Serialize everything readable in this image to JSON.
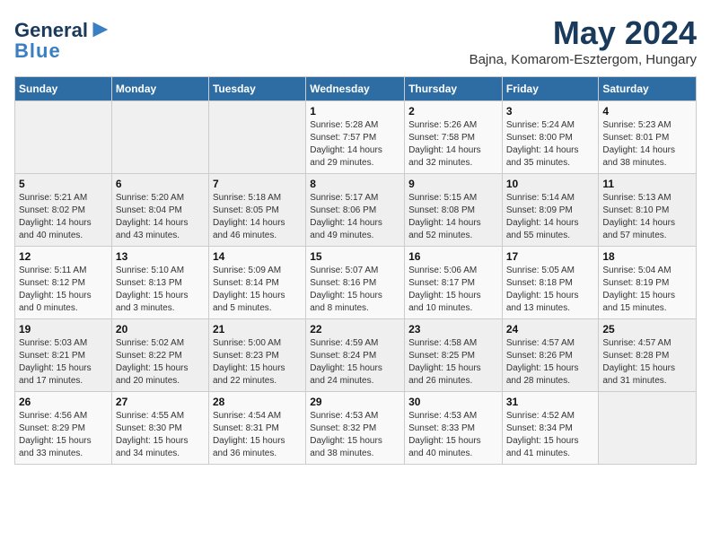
{
  "logo": {
    "line1": "General",
    "line2": "Blue"
  },
  "title": "May 2024",
  "subtitle": "Bajna, Komarom-Esztergom, Hungary",
  "days_header": [
    "Sunday",
    "Monday",
    "Tuesday",
    "Wednesday",
    "Thursday",
    "Friday",
    "Saturday"
  ],
  "weeks": [
    [
      {
        "num": "",
        "info": ""
      },
      {
        "num": "",
        "info": ""
      },
      {
        "num": "",
        "info": ""
      },
      {
        "num": "1",
        "info": "Sunrise: 5:28 AM\nSunset: 7:57 PM\nDaylight: 14 hours\nand 29 minutes."
      },
      {
        "num": "2",
        "info": "Sunrise: 5:26 AM\nSunset: 7:58 PM\nDaylight: 14 hours\nand 32 minutes."
      },
      {
        "num": "3",
        "info": "Sunrise: 5:24 AM\nSunset: 8:00 PM\nDaylight: 14 hours\nand 35 minutes."
      },
      {
        "num": "4",
        "info": "Sunrise: 5:23 AM\nSunset: 8:01 PM\nDaylight: 14 hours\nand 38 minutes."
      }
    ],
    [
      {
        "num": "5",
        "info": "Sunrise: 5:21 AM\nSunset: 8:02 PM\nDaylight: 14 hours\nand 40 minutes."
      },
      {
        "num": "6",
        "info": "Sunrise: 5:20 AM\nSunset: 8:04 PM\nDaylight: 14 hours\nand 43 minutes."
      },
      {
        "num": "7",
        "info": "Sunrise: 5:18 AM\nSunset: 8:05 PM\nDaylight: 14 hours\nand 46 minutes."
      },
      {
        "num": "8",
        "info": "Sunrise: 5:17 AM\nSunset: 8:06 PM\nDaylight: 14 hours\nand 49 minutes."
      },
      {
        "num": "9",
        "info": "Sunrise: 5:15 AM\nSunset: 8:08 PM\nDaylight: 14 hours\nand 52 minutes."
      },
      {
        "num": "10",
        "info": "Sunrise: 5:14 AM\nSunset: 8:09 PM\nDaylight: 14 hours\nand 55 minutes."
      },
      {
        "num": "11",
        "info": "Sunrise: 5:13 AM\nSunset: 8:10 PM\nDaylight: 14 hours\nand 57 minutes."
      }
    ],
    [
      {
        "num": "12",
        "info": "Sunrise: 5:11 AM\nSunset: 8:12 PM\nDaylight: 15 hours\nand 0 minutes."
      },
      {
        "num": "13",
        "info": "Sunrise: 5:10 AM\nSunset: 8:13 PM\nDaylight: 15 hours\nand 3 minutes."
      },
      {
        "num": "14",
        "info": "Sunrise: 5:09 AM\nSunset: 8:14 PM\nDaylight: 15 hours\nand 5 minutes."
      },
      {
        "num": "15",
        "info": "Sunrise: 5:07 AM\nSunset: 8:16 PM\nDaylight: 15 hours\nand 8 minutes."
      },
      {
        "num": "16",
        "info": "Sunrise: 5:06 AM\nSunset: 8:17 PM\nDaylight: 15 hours\nand 10 minutes."
      },
      {
        "num": "17",
        "info": "Sunrise: 5:05 AM\nSunset: 8:18 PM\nDaylight: 15 hours\nand 13 minutes."
      },
      {
        "num": "18",
        "info": "Sunrise: 5:04 AM\nSunset: 8:19 PM\nDaylight: 15 hours\nand 15 minutes."
      }
    ],
    [
      {
        "num": "19",
        "info": "Sunrise: 5:03 AM\nSunset: 8:21 PM\nDaylight: 15 hours\nand 17 minutes."
      },
      {
        "num": "20",
        "info": "Sunrise: 5:02 AM\nSunset: 8:22 PM\nDaylight: 15 hours\nand 20 minutes."
      },
      {
        "num": "21",
        "info": "Sunrise: 5:00 AM\nSunset: 8:23 PM\nDaylight: 15 hours\nand 22 minutes."
      },
      {
        "num": "22",
        "info": "Sunrise: 4:59 AM\nSunset: 8:24 PM\nDaylight: 15 hours\nand 24 minutes."
      },
      {
        "num": "23",
        "info": "Sunrise: 4:58 AM\nSunset: 8:25 PM\nDaylight: 15 hours\nand 26 minutes."
      },
      {
        "num": "24",
        "info": "Sunrise: 4:57 AM\nSunset: 8:26 PM\nDaylight: 15 hours\nand 28 minutes."
      },
      {
        "num": "25",
        "info": "Sunrise: 4:57 AM\nSunset: 8:28 PM\nDaylight: 15 hours\nand 31 minutes."
      }
    ],
    [
      {
        "num": "26",
        "info": "Sunrise: 4:56 AM\nSunset: 8:29 PM\nDaylight: 15 hours\nand 33 minutes."
      },
      {
        "num": "27",
        "info": "Sunrise: 4:55 AM\nSunset: 8:30 PM\nDaylight: 15 hours\nand 34 minutes."
      },
      {
        "num": "28",
        "info": "Sunrise: 4:54 AM\nSunset: 8:31 PM\nDaylight: 15 hours\nand 36 minutes."
      },
      {
        "num": "29",
        "info": "Sunrise: 4:53 AM\nSunset: 8:32 PM\nDaylight: 15 hours\nand 38 minutes."
      },
      {
        "num": "30",
        "info": "Sunrise: 4:53 AM\nSunset: 8:33 PM\nDaylight: 15 hours\nand 40 minutes."
      },
      {
        "num": "31",
        "info": "Sunrise: 4:52 AM\nSunset: 8:34 PM\nDaylight: 15 hours\nand 41 minutes."
      },
      {
        "num": "",
        "info": ""
      }
    ]
  ]
}
